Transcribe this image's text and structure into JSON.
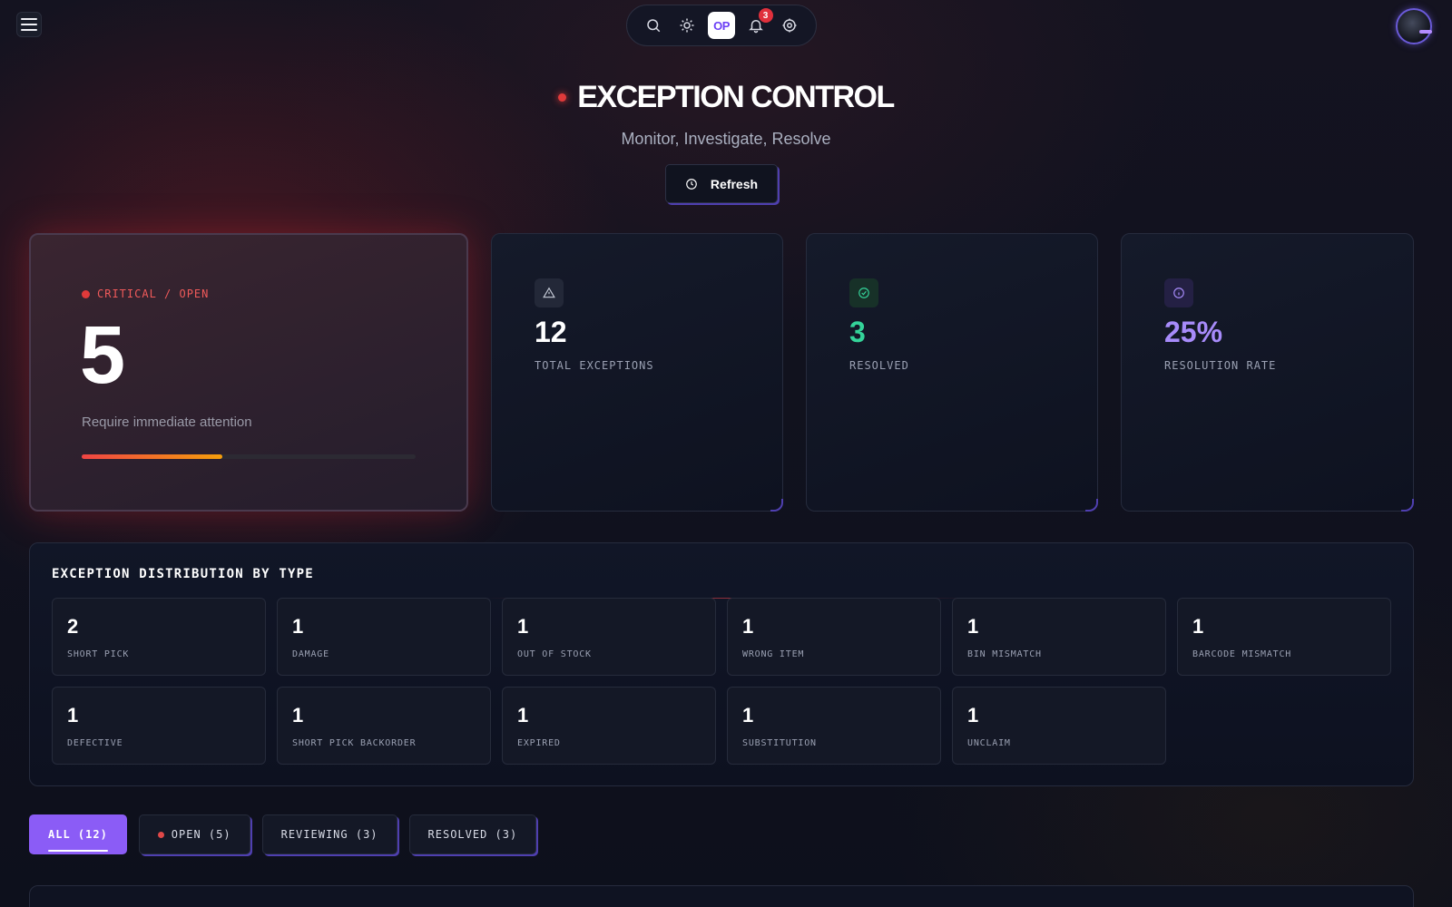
{
  "topbar": {
    "profile_badge": "OP",
    "notification_count": "3",
    "icons": [
      "search-icon",
      "sun-icon",
      "bell-icon",
      "gear-icon"
    ]
  },
  "header": {
    "title": "EXCEPTION CONTROL",
    "subtitle": "Monitor, Investigate, Resolve",
    "refresh_label": "Refresh"
  },
  "critical": {
    "label": "CRITICAL / OPEN",
    "value": "5",
    "description": "Require immediate attention",
    "progress": 0.42
  },
  "stats": [
    {
      "value": "12",
      "label": "TOTAL EXCEPTIONS",
      "icon": "warning-icon",
      "color": "#ffffff"
    },
    {
      "value": "3",
      "label": "RESOLVED",
      "icon": "check-circle-icon",
      "color": "#34d399"
    },
    {
      "value": "25%",
      "label": "RESOLUTION RATE",
      "icon": "info-icon",
      "color": "#a78bfa"
    }
  ],
  "distribution": {
    "title": "EXCEPTION DISTRIBUTION BY TYPE",
    "items": [
      {
        "value": "2",
        "label": "SHORT PICK"
      },
      {
        "value": "1",
        "label": "DAMAGE"
      },
      {
        "value": "1",
        "label": "OUT OF STOCK"
      },
      {
        "value": "1",
        "label": "WRONG ITEM"
      },
      {
        "value": "1",
        "label": "BIN MISMATCH"
      },
      {
        "value": "1",
        "label": "BARCODE MISMATCH"
      },
      {
        "value": "1",
        "label": "DEFECTIVE"
      },
      {
        "value": "1",
        "label": "SHORT PICK BACKORDER"
      },
      {
        "value": "1",
        "label": "EXPIRED"
      },
      {
        "value": "1",
        "label": "SUBSTITUTION"
      },
      {
        "value": "1",
        "label": "UNCLAIM"
      }
    ]
  },
  "filters": [
    {
      "label": "ALL (12)",
      "active": true
    },
    {
      "label": "OPEN (5)",
      "active": false
    },
    {
      "label": "REVIEWING (3)",
      "active": false
    },
    {
      "label": "RESOLVED (3)",
      "active": false
    }
  ],
  "colors": {
    "accent": "#8b5cf6",
    "critical": "#ef4444",
    "success": "#34d399"
  }
}
